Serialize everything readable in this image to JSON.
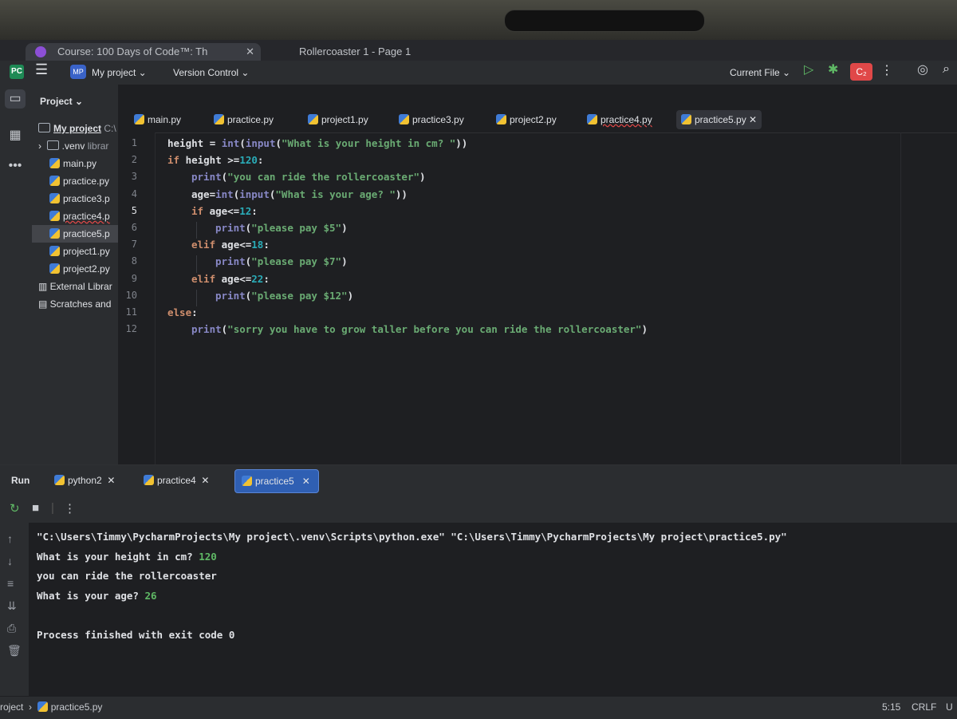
{
  "browser": {
    "tab1_label": "Course: 100 Days of Code™: Th",
    "tab2_label": "Rollercoaster 1 - Page 1"
  },
  "topbar": {
    "project_badge": "MP",
    "project_name": "My project ⌄",
    "version_control": "Version Control ⌄",
    "run_config": "Current File ⌄",
    "code_badge": "C₂"
  },
  "project_panel": {
    "header": "Project ⌄",
    "items": [
      {
        "label": "My project",
        "suffix": "C:\\"
      },
      {
        "label": ".venv",
        "suffix": "librar"
      },
      {
        "label": "main.py"
      },
      {
        "label": "practice.py"
      },
      {
        "label": "practice3.p"
      },
      {
        "label": "practice4.p"
      },
      {
        "label": "practice5.p"
      },
      {
        "label": "project1.py"
      },
      {
        "label": "project2.py"
      },
      {
        "label": "External Librar"
      },
      {
        "label": "Scratches and"
      }
    ]
  },
  "editor": {
    "tabs": [
      "main.py",
      "practice.py",
      "project1.py",
      "practice3.py",
      "project2.py",
      "practice4.py",
      "practice5.py"
    ],
    "active_tab": "practice5.py",
    "line_numbers": [
      "1",
      "2",
      "3",
      "4",
      "5",
      "6",
      "7",
      "8",
      "9",
      "10",
      "11",
      "12"
    ],
    "current_line": 5,
    "code": [
      {
        "indent": "",
        "parts": [
          [
            "var",
            "height "
          ],
          [
            "var",
            "= "
          ],
          [
            "bi",
            "int"
          ],
          [
            "var",
            "("
          ],
          [
            "bi",
            "input"
          ],
          [
            "var",
            "("
          ],
          [
            "str",
            "\"What is your height in cm? \""
          ],
          [
            "var",
            "))"
          ]
        ]
      },
      {
        "indent": "",
        "parts": [
          [
            "kw",
            "if "
          ],
          [
            "var",
            "height >="
          ],
          [
            "num",
            "120"
          ],
          [
            "var",
            ":"
          ]
        ]
      },
      {
        "indent": "    ",
        "parts": [
          [
            "bi",
            "print"
          ],
          [
            "var",
            "("
          ],
          [
            "str",
            "\"you can ride the rollercoaster\""
          ],
          [
            "var",
            ")"
          ]
        ]
      },
      {
        "indent": "    ",
        "parts": [
          [
            "var",
            "age="
          ],
          [
            "bi",
            "int"
          ],
          [
            "var",
            "("
          ],
          [
            "bi",
            "input"
          ],
          [
            "var",
            "("
          ],
          [
            "str",
            "\"What is your age? \""
          ],
          [
            "var",
            "))"
          ]
        ]
      },
      {
        "indent": "    ",
        "parts": [
          [
            "kw",
            "if "
          ],
          [
            "var",
            "age<="
          ],
          [
            "num",
            "12"
          ],
          [
            "var",
            ":"
          ]
        ]
      },
      {
        "indent": "        ",
        "parts": [
          [
            "bi",
            "print"
          ],
          [
            "var",
            "("
          ],
          [
            "str",
            "\"please pay $5\""
          ],
          [
            "var",
            ")"
          ]
        ]
      },
      {
        "indent": "    ",
        "parts": [
          [
            "kw",
            "elif "
          ],
          [
            "var",
            "age<="
          ],
          [
            "num",
            "18"
          ],
          [
            "var",
            ":"
          ]
        ]
      },
      {
        "indent": "        ",
        "parts": [
          [
            "bi",
            "print"
          ],
          [
            "var",
            "("
          ],
          [
            "str",
            "\"please pay $7\""
          ],
          [
            "var",
            ")"
          ]
        ]
      },
      {
        "indent": "    ",
        "parts": [
          [
            "kw",
            "elif "
          ],
          [
            "var",
            "age<="
          ],
          [
            "num",
            "22"
          ],
          [
            "var",
            ":"
          ]
        ]
      },
      {
        "indent": "        ",
        "parts": [
          [
            "bi",
            "print"
          ],
          [
            "var",
            "("
          ],
          [
            "str",
            "\"please pay $12\""
          ],
          [
            "var",
            ")"
          ]
        ]
      },
      {
        "indent": "",
        "parts": [
          [
            "kw",
            "else"
          ],
          [
            "var",
            ":"
          ]
        ]
      },
      {
        "indent": "    ",
        "parts": [
          [
            "bi",
            "print"
          ],
          [
            "var",
            "("
          ],
          [
            "str",
            "\"sorry you have to grow taller before you can ride the rollercoaster\""
          ],
          [
            "var",
            ")"
          ]
        ]
      }
    ]
  },
  "run_panel": {
    "run_label": "Run",
    "tabs": [
      "python2",
      "practice4",
      "practice5"
    ],
    "active_tab": "practice5",
    "console": [
      {
        "text": "\"C:\\Users\\Timmy\\PycharmProjects\\My project\\.venv\\Scripts\\python.exe\" \"C:\\Users\\Timmy\\PycharmProjects\\My project\\practice5.py\"",
        "input": ""
      },
      {
        "text": "What is your height in cm? ",
        "input": "120"
      },
      {
        "text": "you can ride the rollercoaster",
        "input": ""
      },
      {
        "text": "What is your age? ",
        "input": "26"
      },
      {
        "text": "",
        "input": ""
      },
      {
        "text": "Process finished with exit code 0",
        "input": ""
      }
    ]
  },
  "statusbar": {
    "breadcrumb_project": "roject",
    "breadcrumb_file": "practice5.py",
    "position": "5:15",
    "line_ending": "CRLF",
    "encoding": "U"
  },
  "colors": {
    "accent": "#2f5fb3",
    "keyword": "#cf8e6d",
    "string": "#6aab73",
    "number": "#2aacb8",
    "builtin": "#8888c6",
    "error_badge": "#e04848"
  },
  "icons": [
    "app-logo-icon",
    "hamburger-menu-icon",
    "folder-icon",
    "structure-icon",
    "python-file-icon",
    "run-icon",
    "debug-icon",
    "more-icon",
    "ai-assistant-icon",
    "search-icon",
    "rerun-icon",
    "stop-icon",
    "arrow-up-icon",
    "arrow-down-icon",
    "soft-wrap-icon",
    "scroll-to-end-icon",
    "print-icon",
    "trash-icon",
    "close-icon"
  ]
}
